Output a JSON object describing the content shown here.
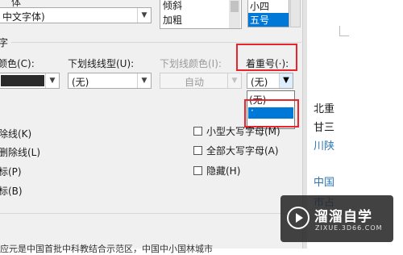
{
  "font_dialog": {
    "top_label_partial": "体",
    "script_font": {
      "value": "中文字体)"
    },
    "style_list": [
      "倾斜",
      "加粗"
    ],
    "size_list": [
      "小四",
      "五号"
    ],
    "section_partial": "字",
    "font_color_label": "颜色(C):",
    "underline_style_label": "下划线线型(U):",
    "underline_style_value": "(无)",
    "underline_color_label": "下划线颜色(I):",
    "underline_color_value": "自动",
    "emphasis_label": "着重号(·):",
    "emphasis_value": "(无)",
    "emphasis_options": [
      "(无)",
      "·"
    ],
    "effects_left": [
      "除线(K)",
      "删除线(L)",
      "标(P)",
      "标(B)"
    ],
    "effects_right": [
      "小型大写字母(M)",
      "全部大写字母(A)",
      "隐藏(H)"
    ],
    "preview_text": "应元是中国首批中科教结合示范区，中国中小国林城市"
  },
  "document": {
    "lines": [
      "北重",
      "甘三",
      "川陕",
      "中国",
      "市占"
    ]
  },
  "watermark": {
    "brand": "溜溜自学",
    "site": "ZIXUE.3D66.COM"
  },
  "colors": {
    "highlight_red": "#e8242d",
    "selection_blue": "#0078d7",
    "link_blue": "#2e75b6"
  }
}
